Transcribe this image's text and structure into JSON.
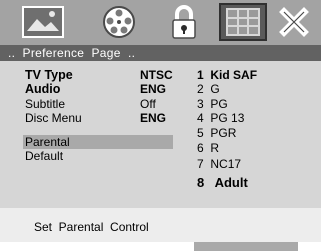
{
  "icons": [
    {
      "name": "picture-icon",
      "selected": false
    },
    {
      "name": "film-reel-icon",
      "selected": false
    },
    {
      "name": "lock-icon",
      "selected": false
    },
    {
      "name": "grid-icon",
      "selected": true
    },
    {
      "name": "close-x-icon",
      "selected": false
    }
  ],
  "header": {
    "title": "..  Preference  Page  .."
  },
  "settings": [
    {
      "label": "TV Type",
      "value": "NTSC",
      "bold": true
    },
    {
      "label": "Audio",
      "value": "ENG",
      "bold": true
    },
    {
      "label": "Subtitle",
      "value": "Off",
      "bold": false
    },
    {
      "label": "Disc  Menu",
      "value": "ENG",
      "bold": false
    },
    {
      "label": "Parental",
      "value": "",
      "bold": false,
      "selected": true
    },
    {
      "label": "Default",
      "value": "",
      "bold": false
    }
  ],
  "parental_options": [
    {
      "num": "1",
      "label": "Kid SAF",
      "bold": true
    },
    {
      "num": "2",
      "label": "G",
      "bold": false
    },
    {
      "num": "3",
      "label": "PG",
      "bold": false
    },
    {
      "num": "4",
      "label": "PG 13",
      "bold": false
    },
    {
      "num": "5",
      "label": "PGR",
      "bold": false
    },
    {
      "num": "6",
      "label": "R",
      "bold": false
    },
    {
      "num": "7",
      "label": "NC17",
      "bold": false
    },
    {
      "num": "8",
      "label": "Adult",
      "bold": true,
      "selected": true
    }
  ],
  "footer": {
    "hint": "Set  Parental  Control"
  },
  "colors": {
    "icon_bar": "#a3a3a3",
    "header_bar": "#626262",
    "content_bg": "#d6d6d6",
    "highlight": "#a9a9a9",
    "footer_bg": "#ededed"
  }
}
